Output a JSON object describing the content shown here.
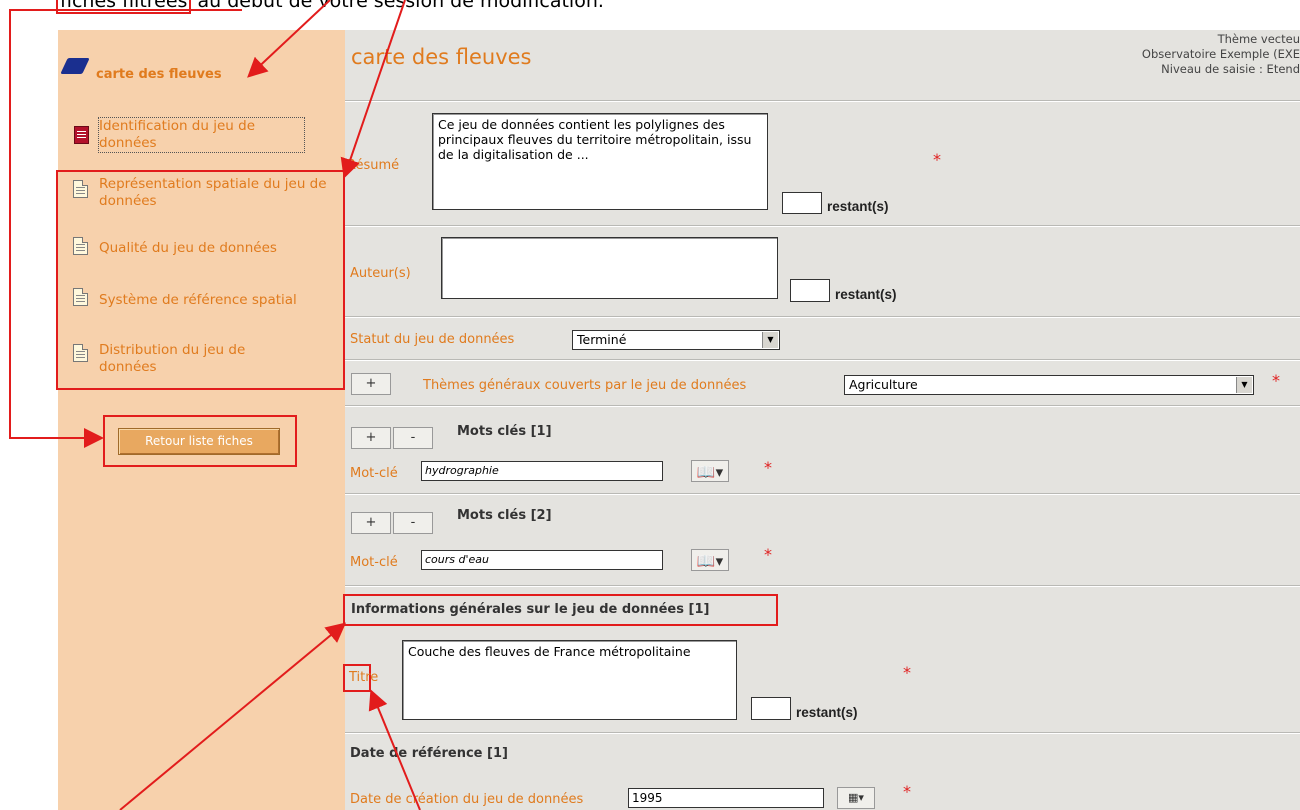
{
  "caption": {
    "boxed_word": "fiches filtrées",
    "rest": "au début de votre session de modification."
  },
  "sidebar": {
    "title": "carte des fleuves",
    "items": [
      {
        "label": "Identification du jeu de données",
        "icon": "document-red-icon"
      },
      {
        "label": "Représentation spatiale du jeu de données",
        "icon": "document-icon"
      },
      {
        "label": "Qualité du jeu de données",
        "icon": "document-icon"
      },
      {
        "label": "Système de référence spatial",
        "icon": "document-icon"
      },
      {
        "label": "Distribution du jeu de données",
        "icon": "document-icon"
      }
    ],
    "back_button": "Retour liste fiches"
  },
  "header": {
    "title": "carte des fleuves",
    "info": [
      "Thème vecteu",
      "Observatoire Exemple (EXE",
      "Niveau de saisie : Etend"
    ]
  },
  "form": {
    "resume": {
      "label": "Résumé",
      "value": "Ce jeu de données contient  les polylignes des principaux fleuves du territoire métropolitain, issu de la digitalisation de ...",
      "remaining": "restant(s)"
    },
    "auteurs": {
      "label": "Auteur(s)",
      "value": "",
      "remaining": "restant(s)"
    },
    "statut": {
      "label": "Statut du jeu de données",
      "value": "Terminé"
    },
    "themes": {
      "label": "Thèmes généraux couverts par le jeu de données",
      "value": "Agriculture",
      "plus": "+"
    },
    "mots_cles": [
      {
        "header": "Mots clés [1]",
        "label": "Mot-clé",
        "value": "hydrographie",
        "plus": "+",
        "minus": "-"
      },
      {
        "header": "Mots clés [2]",
        "label": "Mot-clé",
        "value": "cours d'eau",
        "plus": "+",
        "minus": "-"
      }
    ],
    "infos_generales": {
      "header": "Informations générales sur le jeu de données [1]"
    },
    "titre": {
      "label": "Titre",
      "value": "Couche des fleuves de France métropolitaine",
      "remaining": "restant(s)"
    },
    "date_reference": {
      "header": "Date de référence [1]"
    },
    "date_creation": {
      "label": "Date de création du jeu de données",
      "value": "1995"
    },
    "required_mark": "*"
  },
  "colors": {
    "sidebar_bg": "#f7d1ac",
    "main_bg": "#e4e3df",
    "accent_orange": "#e07b1e",
    "annotation_red": "#e21c1c"
  }
}
